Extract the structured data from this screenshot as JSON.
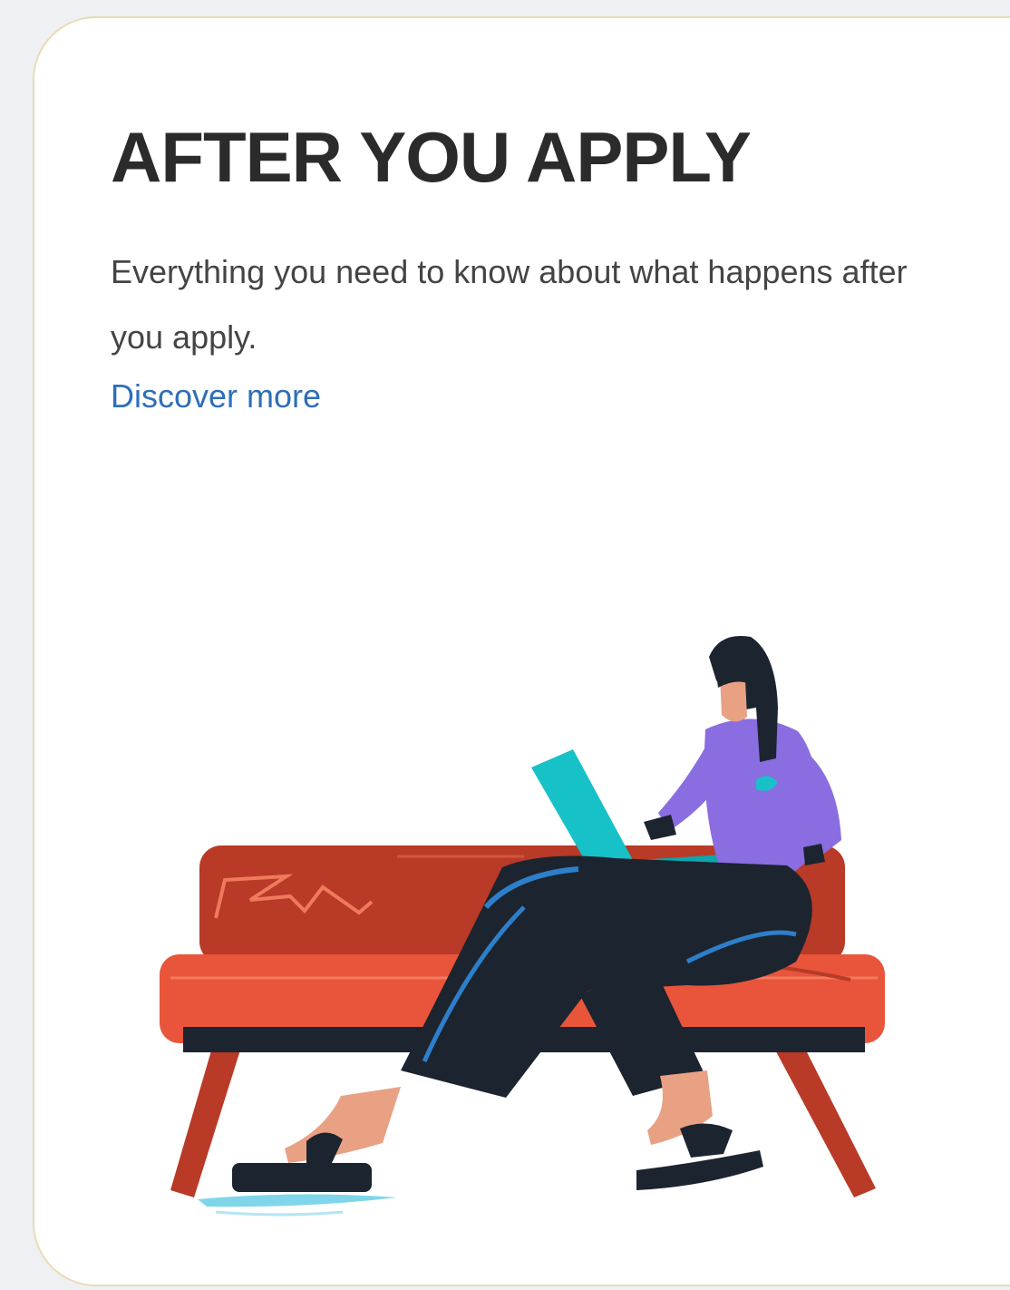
{
  "card": {
    "title": "AFTER YOU APPLY",
    "description": "Everything you need to know about what happens after you apply.",
    "link_label": "Discover more"
  },
  "colors": {
    "title": "#2b2b2b",
    "body_text": "#444444",
    "link": "#2e6fb8",
    "card_border": "#e9dcb4",
    "sofa": "#e8553a",
    "sofa_back": "#b83a27",
    "shirt": "#8a6de0",
    "laptop": "#17c1c8",
    "pants": "#1c2430"
  },
  "illustration": {
    "subject": "woman-on-sofa-with-laptop"
  }
}
